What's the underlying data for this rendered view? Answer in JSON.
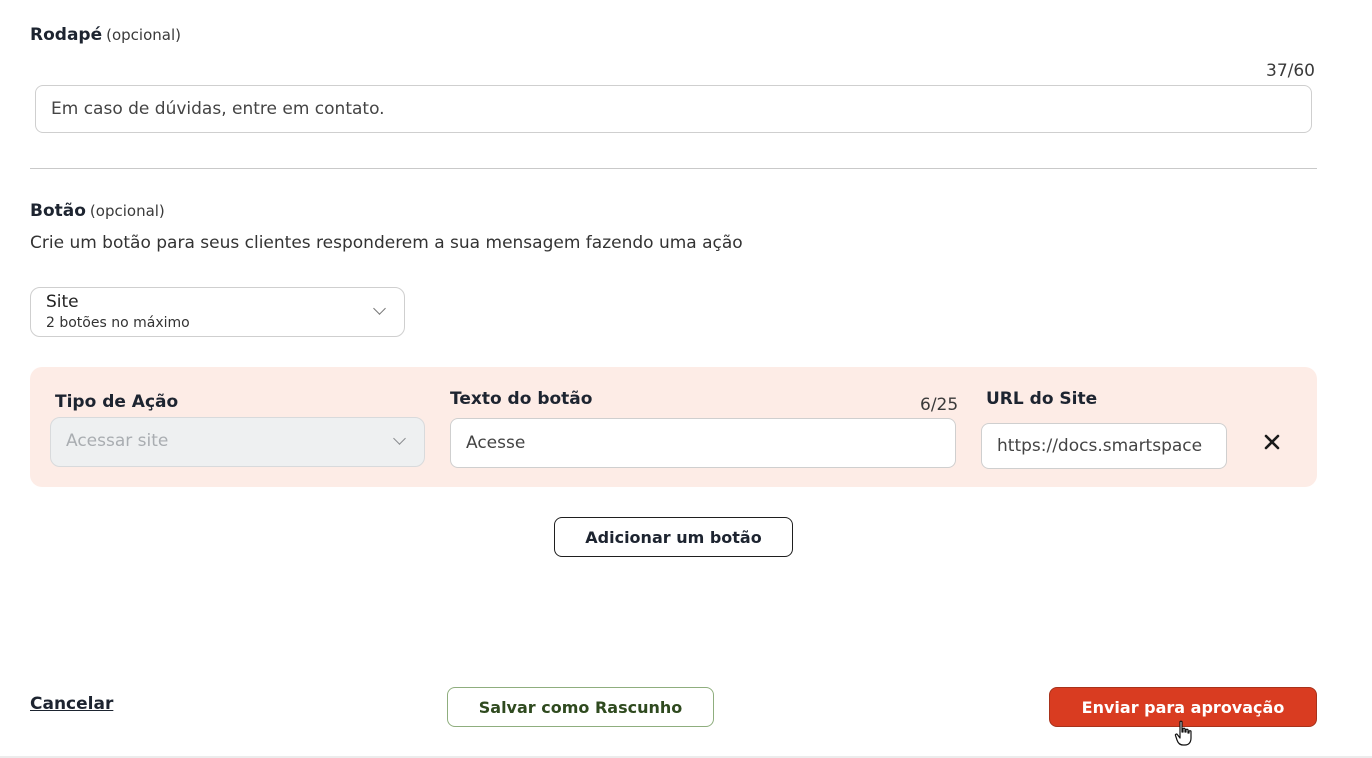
{
  "footer_section": {
    "label": "Rodapé",
    "optional": "(opcional)",
    "counter": "37/60",
    "value": "Em caso de dúvidas, entre em contato."
  },
  "button_section": {
    "label": "Botão",
    "optional": "(opcional)",
    "description": "Crie um botão para seus clientes responderem a sua mensagem fazendo uma ação",
    "type_select": {
      "value": "Site",
      "hint": "2 botões no máximo"
    },
    "action_row": {
      "action_type_label": "Tipo de Ação",
      "action_type_placeholder": "Acessar site",
      "button_text_label": "Texto do botão",
      "button_text_counter": "6/25",
      "button_text_value": "Acesse",
      "url_label": "URL do Site",
      "url_value": "https://docs.smartspace"
    },
    "add_button_label": "Adicionar um botão"
  },
  "footer_actions": {
    "cancel_label": "Cancelar",
    "draft_label": "Salvar como Rascunho",
    "submit_label": "Enviar para aprovação"
  },
  "icons": {
    "dropdown": "chevron-down-icon",
    "remove": "close-icon",
    "cursor": "hand-pointer-icon"
  },
  "colors": {
    "panel_background": "#fdece6",
    "submit_background": "#d93c21",
    "draft_border": "#8fae7e",
    "draft_text": "#2f4a1f"
  }
}
